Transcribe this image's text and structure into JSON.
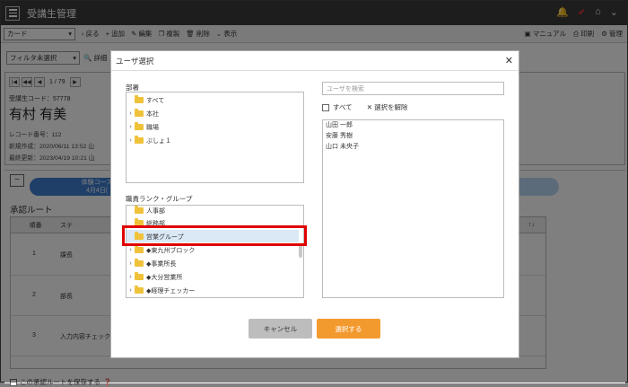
{
  "app": {
    "title": "受講生管理"
  },
  "toolbar": {
    "view_select": "カード",
    "back": "戻る",
    "add": "追加",
    "edit": "編集",
    "copy": "複製",
    "delete": "削除",
    "display": "表示",
    "manual": "マニュアル",
    "print": "印刷",
    "manage": "管理"
  },
  "filter": {
    "select": "フィルタ未選択",
    "detail": "詳細"
  },
  "record": {
    "page": "1 / 79",
    "code": "受講生コード：57778",
    "name": "有村 有美",
    "record_no": "レコード番号：112",
    "created": "新規作成：2020/06/11 13:52 山",
    "updated": "最終更新：2023/04/19 10:21 山"
  },
  "course": {
    "label": "体験コース",
    "sub": "4月4日("
  },
  "route": {
    "title": "承認ルート",
    "col_no": "順番",
    "col_step": "ステ",
    "col_sort": "↑↓",
    "rows": [
      {
        "no": "1",
        "step": "課長"
      },
      {
        "no": "2",
        "step": "部長"
      },
      {
        "no": "3",
        "step": "入力内容チェック"
      }
    ],
    "save_label": "この承認ルートを保存する"
  },
  "dialog": {
    "title": "ユーザ選択",
    "dept_label": "部署",
    "dept_items": [
      "すべて",
      "本社",
      "職場",
      "ぶしょ１"
    ],
    "group_label": "職責ランク・グループ",
    "group_items": [
      "人事部",
      "総務部",
      "営業グループ",
      "◆東九州ブロック",
      "◆事業所長",
      "◆大分営業所",
      "◆経理チェッカー"
    ],
    "search_placeholder": "ユーザを検索",
    "all_label": "すべて",
    "clear_label": "選択を解除",
    "users": [
      "山田 一郎",
      "安藤 秀樹",
      "山口 未央子"
    ],
    "cancel_label": "キャンセル",
    "select_label": "選択する"
  },
  "colors": {
    "titlebar": "#3a3a3a",
    "accent_blue": "#3f7fd0",
    "highlight": "#e00000",
    "orange": "#f39a2e"
  }
}
